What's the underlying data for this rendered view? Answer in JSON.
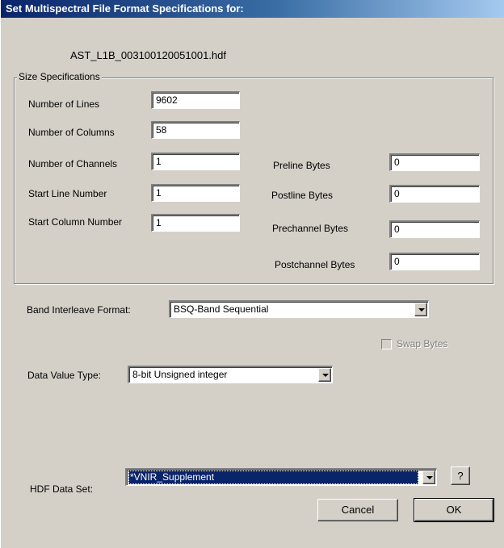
{
  "window": {
    "title": "Set Multispectral File Format Specifications for:",
    "filename": "AST_L1B_003100120051001.hdf"
  },
  "size_specs": {
    "group_label": "Size Specifications",
    "number_of_lines": {
      "label": "Number of Lines",
      "value": "9602"
    },
    "number_of_columns": {
      "label": "Number of Columns",
      "value": "58"
    },
    "number_of_channels": {
      "label": "Number of Channels",
      "value": "1"
    },
    "start_line_number": {
      "label": "Start Line Number",
      "value": "1"
    },
    "start_column_number": {
      "label": "Start Column Number",
      "value": "1"
    },
    "preline_bytes": {
      "label": "Preline Bytes",
      "value": "0"
    },
    "postline_bytes": {
      "label": "Postline Bytes",
      "value": "0"
    },
    "prechannel_bytes": {
      "label": "Prechannel Bytes",
      "value": "0"
    },
    "postchannel_bytes": {
      "label": "Postchannel Bytes",
      "value": "0"
    }
  },
  "band_interleave": {
    "label": "Band Interleave Format:",
    "value": "BSQ-Band Sequential"
  },
  "swap_bytes": {
    "label": "Swap Bytes",
    "checked": false,
    "enabled": false
  },
  "data_value_type": {
    "label": "Data Value Type:",
    "value": "8-bit Unsigned integer"
  },
  "hdf_data_set": {
    "label": "HDF Data Set:",
    "value": "*VNIR_Supplement",
    "help_label": "?"
  },
  "buttons": {
    "cancel": "Cancel",
    "ok": "OK"
  }
}
